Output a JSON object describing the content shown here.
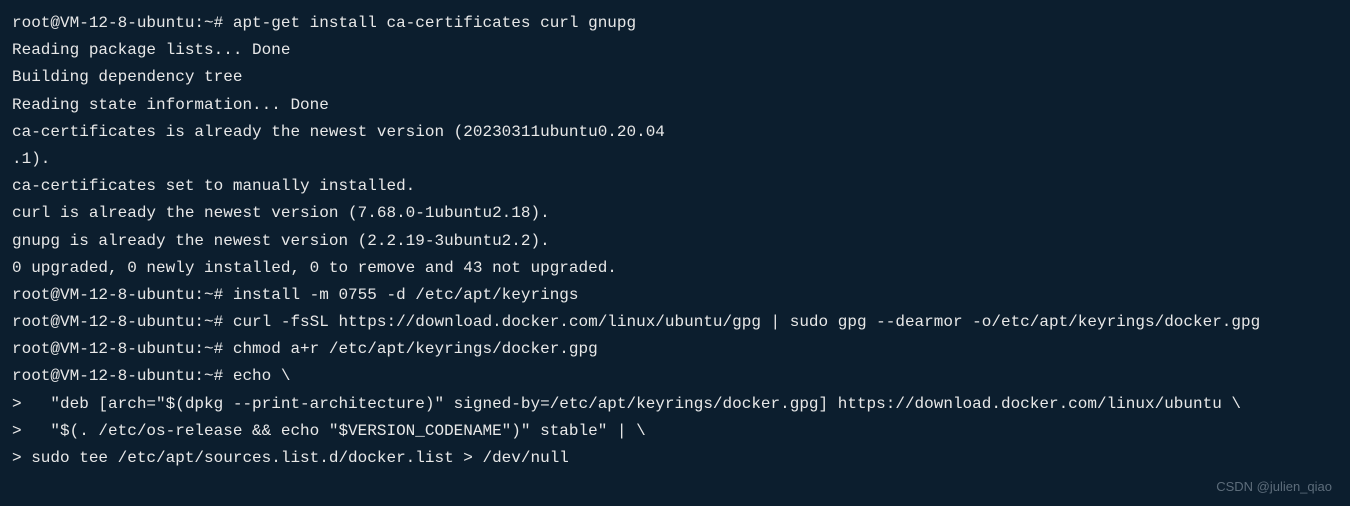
{
  "terminal": {
    "lines": [
      "root@VM-12-8-ubuntu:~# apt-get install ca-certificates curl gnupg",
      "Reading package lists... Done",
      "Building dependency tree",
      "Reading state information... Done",
      "ca-certificates is already the newest version (20230311ubuntu0.20.04",
      ".1).",
      "ca-certificates set to manually installed.",
      "curl is already the newest version (7.68.0-1ubuntu2.18).",
      "gnupg is already the newest version (2.2.19-3ubuntu2.2).",
      "0 upgraded, 0 newly installed, 0 to remove and 43 not upgraded.",
      "root@VM-12-8-ubuntu:~# install -m 0755 -d /etc/apt/keyrings",
      "root@VM-12-8-ubuntu:~# curl -fsSL https://download.docker.com/linux/ubuntu/gpg | sudo gpg --dearmor -o/etc/apt/keyrings/docker.gpg",
      "root@VM-12-8-ubuntu:~# chmod a+r /etc/apt/keyrings/docker.gpg",
      "root@VM-12-8-ubuntu:~# echo \\",
      ">   \"deb [arch=\"$(dpkg --print-architecture)\" signed-by=/etc/apt/keyrings/docker.gpg] https://download.docker.com/linux/ubuntu \\",
      ">   \"$(. /etc/os-release && echo \"$VERSION_CODENAME\")\" stable\" | \\",
      "> sudo tee /etc/apt/sources.list.d/docker.list > /dev/null"
    ]
  },
  "watermark": "CSDN @julien_qiao"
}
